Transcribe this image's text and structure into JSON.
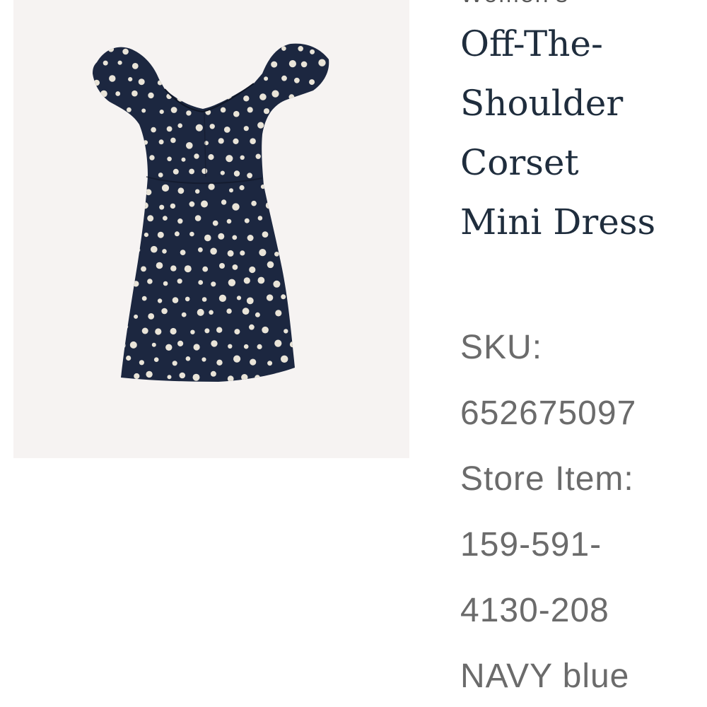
{
  "product": {
    "category": "Women's",
    "title_lines": [
      "Off-The-",
      "Shoulder",
      "Corset",
      "Mini Dress"
    ],
    "image_alt": "navy polka dot off-the-shoulder corset mini dress",
    "colors": {
      "dress": "#1c2740",
      "dots": "#e9e4d8",
      "image_bg": "#f6f3f2",
      "title": "#1f2d3d",
      "meta_text": "#6b6b6b"
    }
  },
  "details": {
    "sku_label": "SKU:",
    "sku_value": "652675097",
    "store_item_label": "Store Item:",
    "store_item_value_line1": "159-591-",
    "store_item_value_line2": "4130-208",
    "color_value": "NAVY blue"
  }
}
